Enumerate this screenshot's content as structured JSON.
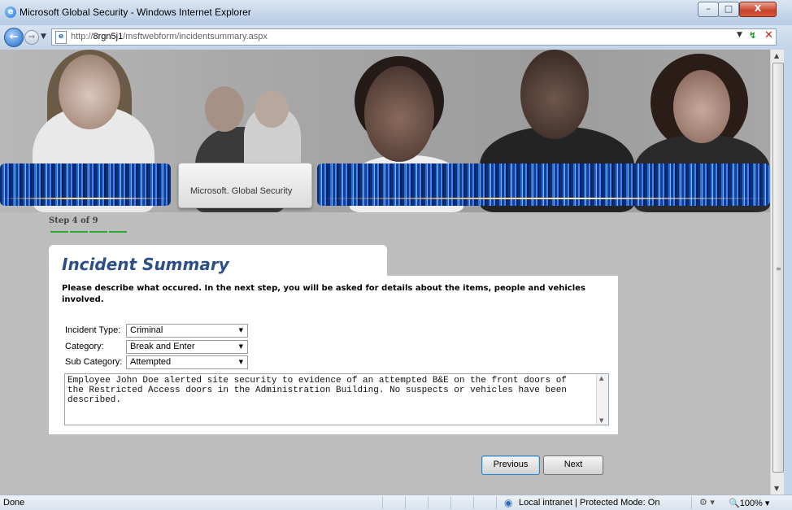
{
  "window": {
    "title": "Microsoft Global Security - Windows Internet Explorer",
    "minimize": "–",
    "maximize": "□",
    "close": "X"
  },
  "address": {
    "url_prefix": "http://",
    "url_host": "8rgn5j1",
    "url_path": "/msftwebform/incidentsummary.aspx"
  },
  "banner": {
    "logo_text": "Microsoft. Global Security"
  },
  "wizard": {
    "step_text": "Step 4 of 9"
  },
  "form": {
    "heading": "Incident Summary",
    "description": "Please describe what occured. In the next step, you will be asked for details about the items, people and vehicles involved.",
    "fields": [
      {
        "label": "Incident Type:",
        "value": "Criminal"
      },
      {
        "label": "Category:",
        "value": "Break and Enter"
      },
      {
        "label": "Sub Category:",
        "value": "Attempted"
      }
    ],
    "notes": "Employee John Doe alerted site security to evidence of an attempted B&E on the front doors of\nthe Restricted Access doors in the Administration Building. No suspects or vehicles have been\ndescribed.",
    "previous_label": "Previous",
    "next_label": "Next"
  },
  "status": {
    "text": "Done",
    "zone": "Local intranet | Protected Mode: On",
    "zoom": "100%"
  },
  "icons": [
    "ie-icon",
    "back-arrow-icon",
    "forward-arrow-icon",
    "page-icon",
    "refresh-icon",
    "stop-icon",
    "globe-zone-icon",
    "security-icon",
    "zoom-icon"
  ]
}
